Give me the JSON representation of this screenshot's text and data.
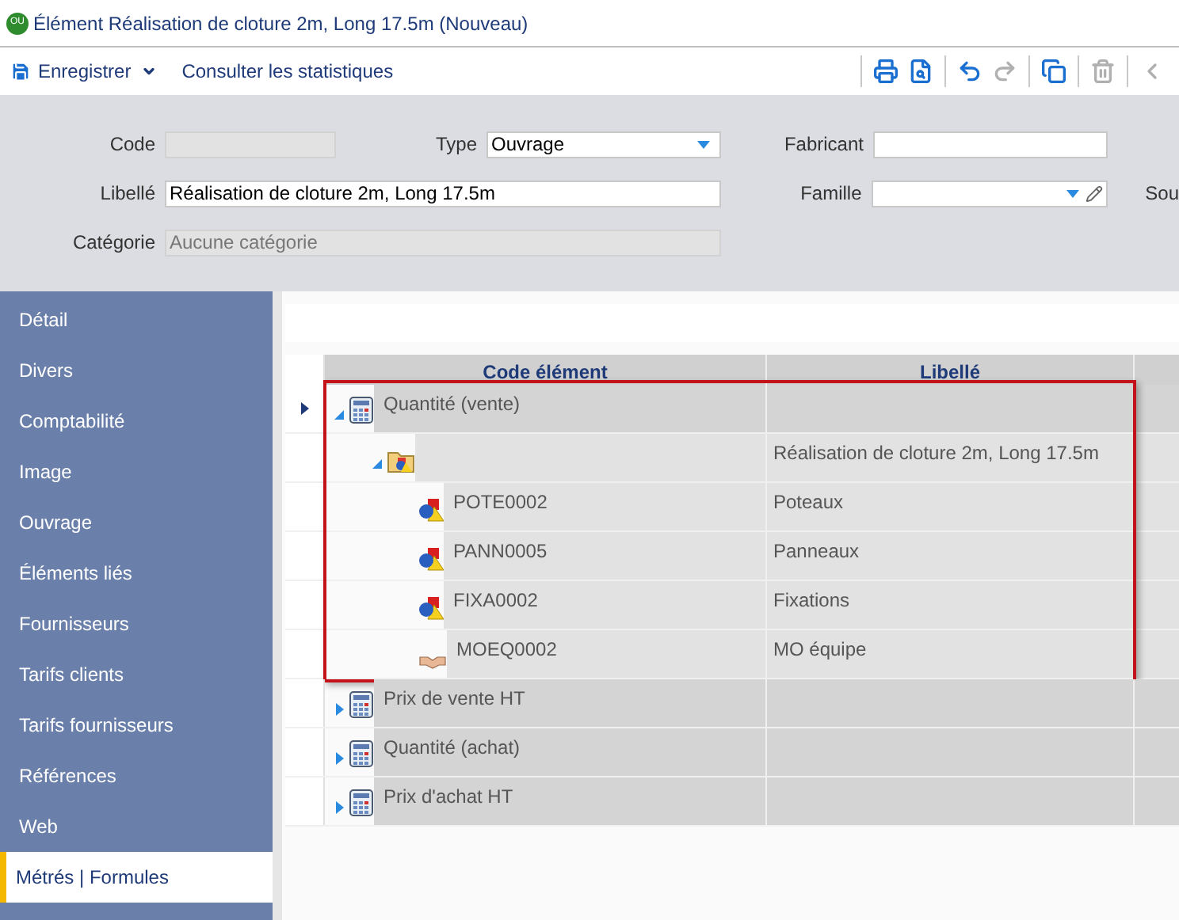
{
  "window": {
    "badge": "OU",
    "title": "Élément Réalisation de cloture 2m, Long 17.5m (Nouveau)"
  },
  "toolbar": {
    "save": "Enregistrer",
    "stats": "Consulter les statistiques",
    "icon_buttons": [
      {
        "disabled": false
      },
      {
        "disabled": false
      },
      {
        "disabled": false
      },
      {
        "disabled": true
      },
      {
        "disabled": false
      },
      {
        "disabled": true
      },
      {
        "disabled": true
      }
    ]
  },
  "form": {
    "code": {
      "label": "Code"
    },
    "type": {
      "label": "Type",
      "value": "Ouvrage"
    },
    "fabricant": {
      "label": "Fabricant"
    },
    "libelle": {
      "label": "Libellé",
      "value": "Réalisation de cloture 2m, Long 17.5m"
    },
    "famille": {
      "label": "Famille"
    },
    "sous": {
      "label": "Sou"
    },
    "categorie": {
      "label": "Catégorie",
      "value": "Aucune catégorie"
    }
  },
  "sidebar": {
    "items": [
      {
        "label": "Détail",
        "selected": false
      },
      {
        "label": "Divers",
        "selected": false
      },
      {
        "label": "Comptabilité",
        "selected": false
      },
      {
        "label": "Image",
        "selected": false
      },
      {
        "label": "Ouvrage",
        "selected": false
      },
      {
        "label": "Éléments liés",
        "selected": false
      },
      {
        "label": "Fournisseurs",
        "selected": false
      },
      {
        "label": "Tarifs clients",
        "selected": false
      },
      {
        "label": "Tarifs fournisseurs",
        "selected": false
      },
      {
        "label": "Références",
        "selected": false
      },
      {
        "label": "Web",
        "selected": false
      },
      {
        "label": "Métrés | Formules",
        "selected": true
      }
    ]
  },
  "tree": {
    "columns": [
      "Code élément",
      "Libellé"
    ],
    "rows": [
      {
        "kind": "calculator",
        "code": "Quantité (vente)",
        "expanded": true,
        "current": true,
        "highlighted": true,
        "children": [
          {
            "kind": "folder",
            "libelle": "Réalisation de cloture 2m, Long 17.5m",
            "expanded": true,
            "children": [
              {
                "kind": "shapes",
                "code": "POTE0002",
                "libelle": "Poteaux"
              },
              {
                "kind": "shapes",
                "code": "PANN0005",
                "libelle": "Panneaux"
              },
              {
                "kind": "shapes",
                "code": "FIXA0002",
                "libelle": "Fixations"
              },
              {
                "kind": "handshake",
                "code": "MOEQ0002",
                "libelle": "MO équipe"
              }
            ]
          }
        ]
      },
      {
        "kind": "calculator",
        "code": "Prix de vente HT",
        "expanded": false,
        "current": false,
        "highlighted": false
      },
      {
        "kind": "calculator",
        "code": "Quantité (achat)",
        "expanded": false,
        "current": false,
        "highlighted": false
      },
      {
        "kind": "calculator",
        "code": "Prix d'achat HT",
        "expanded": false,
        "current": false,
        "highlighted": false
      }
    ]
  }
}
